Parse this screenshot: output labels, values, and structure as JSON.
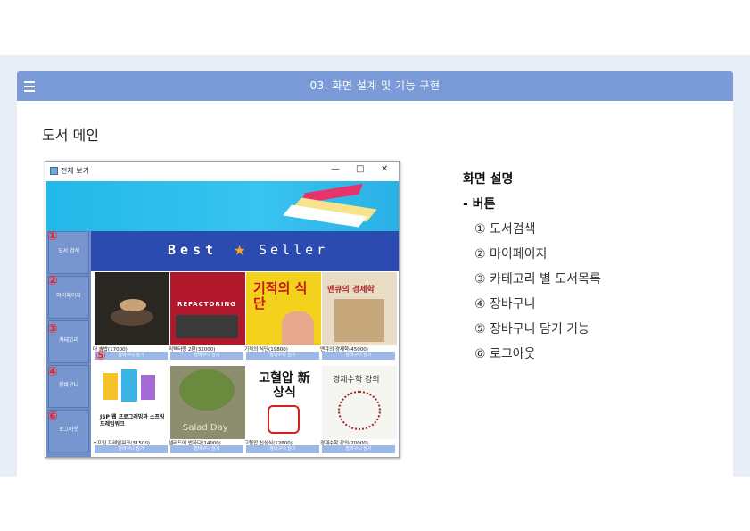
{
  "header": {
    "title": "03. 화면 설계 및 기능 구현"
  },
  "section_title": "도서 메인",
  "app": {
    "window_title": "전체 보기",
    "window_controls": {
      "minimize": "—",
      "maximize": "□",
      "close": "✕"
    },
    "banner": {
      "best": "Best",
      "seller": "Seller"
    },
    "sidebar": [
      {
        "num": "①",
        "label": "도서 검색"
      },
      {
        "num": "②",
        "label": "마이페이지"
      },
      {
        "num": "③",
        "label": "카테고리"
      },
      {
        "num": "④",
        "label": "장바구니"
      },
      {
        "num": "⑥",
        "label": "로그아웃"
      }
    ],
    "cart_marker": "⑤",
    "books": [
      {
        "label": "더 솔밥(17000)",
        "button": "장바구니 담기",
        "cover_text": "",
        "cover_bg": "#2a2622"
      },
      {
        "label": "리팩터링 2판(32000)",
        "button": "장바구니 담기",
        "cover_text": "REFACTORING",
        "cover_bg": "#b2182b"
      },
      {
        "label": "기적의 식단(19800)",
        "button": "장바구니 담기",
        "cover_text": "기적의 식단",
        "cover_bg": "#f2d21c"
      },
      {
        "label": "맨큐의 경제학(45000)",
        "button": "장바구니 담기",
        "cover_text": "맨큐의 경제학",
        "cover_bg": "#e9dcc4"
      },
      {
        "label": "스프링 프레임워크(31500)",
        "button": "장바구니 담기",
        "cover_text": "JSP 웹 프로그래밍과 스프링 프레임워크",
        "cover_bg": "#ffffff"
      },
      {
        "label": "샐러드에 반하다(14000)",
        "button": "장바구니 담기",
        "cover_text": "Salad Day",
        "cover_bg": "#8c8e6e"
      },
      {
        "label": "고혈압 신상식(12600)",
        "button": "장바구니 담기",
        "cover_text": "고혈압 新상식",
        "cover_bg": "#ffffff"
      },
      {
        "label": "경제수학 강의(20000)",
        "button": "장바구니 담기",
        "cover_text": "경제수학 강의",
        "cover_bg": "#f5f5f2"
      }
    ]
  },
  "description": {
    "heading": "화면 설명",
    "sub": "- 버튼",
    "items": [
      "① 도서검색",
      "② 마이페이지",
      "③ 카테고리 별 도서목록",
      "④ 장바구니",
      "⑤ 장바구니 담기 기능",
      "⑥ 로그아웃"
    ]
  },
  "colors": {
    "header": "#7b9ad8",
    "band": "#e8eef8",
    "sidebar": "#6f8fc9",
    "accent_red": "#ee1c1c"
  }
}
